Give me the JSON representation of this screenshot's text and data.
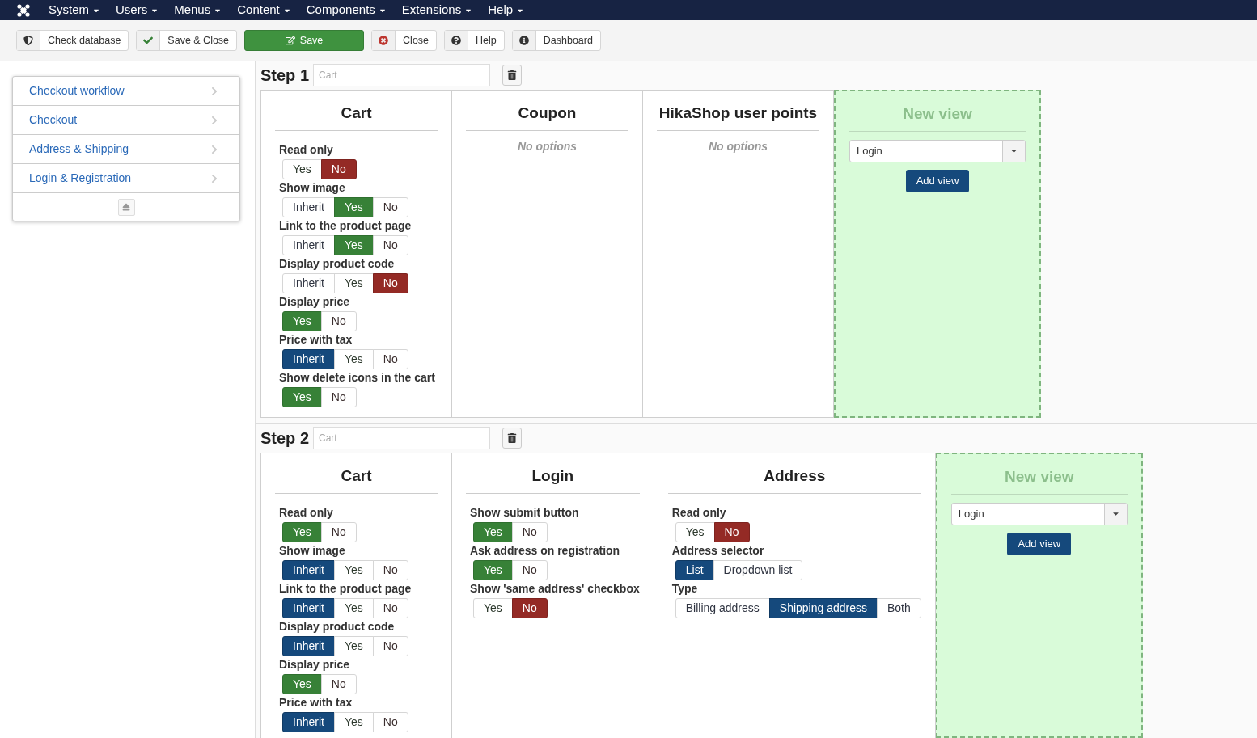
{
  "menubar": {
    "items": [
      {
        "label": "System"
      },
      {
        "label": "Users"
      },
      {
        "label": "Menus"
      },
      {
        "label": "Content"
      },
      {
        "label": "Components"
      },
      {
        "label": "Extensions"
      },
      {
        "label": "Help"
      }
    ]
  },
  "toolbar": [
    {
      "label": "Check database",
      "kind": "shield"
    },
    {
      "label": "Save & Close",
      "kind": "check"
    },
    {
      "label": "Save",
      "kind": "save"
    },
    {
      "label": "Close",
      "kind": "close"
    },
    {
      "label": "Help",
      "kind": "help"
    },
    {
      "label": "Dashboard",
      "kind": "info"
    }
  ],
  "sidebar": {
    "items": [
      {
        "label": "Checkout workflow"
      },
      {
        "label": "Checkout"
      },
      {
        "label": "Address & Shipping"
      },
      {
        "label": "Login & Registration"
      }
    ]
  },
  "steps": [
    {
      "label": "Step 1",
      "name_placeholder": "Cart",
      "views": [
        {
          "kind": "settings",
          "title": "Cart",
          "options": [
            {
              "label": "Read only",
              "choices": [
                {
                  "label": "Yes",
                  "kind": "yes",
                  "selected": false
                },
                {
                  "label": "No",
                  "kind": "no",
                  "selected": true
                }
              ]
            },
            {
              "label": "Show image",
              "choices": [
                {
                  "label": "Inherit",
                  "kind": "other",
                  "selected": false
                },
                {
                  "label": "Yes",
                  "kind": "yes",
                  "selected": true
                },
                {
                  "label": "No",
                  "kind": "no",
                  "selected": false
                }
              ]
            },
            {
              "label": "Link to the product page",
              "choices": [
                {
                  "label": "Inherit",
                  "kind": "other",
                  "selected": false
                },
                {
                  "label": "Yes",
                  "kind": "yes",
                  "selected": true
                },
                {
                  "label": "No",
                  "kind": "no",
                  "selected": false
                }
              ]
            },
            {
              "label": "Display product code",
              "choices": [
                {
                  "label": "Inherit",
                  "kind": "other",
                  "selected": false
                },
                {
                  "label": "Yes",
                  "kind": "yes",
                  "selected": false
                },
                {
                  "label": "No",
                  "kind": "no",
                  "selected": true
                }
              ]
            },
            {
              "label": "Display price",
              "choices": [
                {
                  "label": "Yes",
                  "kind": "yes",
                  "selected": true
                },
                {
                  "label": "No",
                  "kind": "no",
                  "selected": false
                }
              ]
            },
            {
              "label": "Price with tax",
              "choices": [
                {
                  "label": "Inherit",
                  "kind": "other",
                  "selected": true
                },
                {
                  "label": "Yes",
                  "kind": "yes",
                  "selected": false
                },
                {
                  "label": "No",
                  "kind": "no",
                  "selected": false
                }
              ]
            },
            {
              "label": "Show delete icons in the cart",
              "choices": [
                {
                  "label": "Yes",
                  "kind": "yes",
                  "selected": true
                },
                {
                  "label": "No",
                  "kind": "no",
                  "selected": false
                }
              ]
            }
          ]
        },
        {
          "kind": "empty",
          "title": "Coupon",
          "note": "No options"
        },
        {
          "kind": "empty",
          "title": "HikaShop user points",
          "note": "No options"
        }
      ],
      "new_view": {
        "title": "New view",
        "select_value": "Login",
        "button": "Add view"
      }
    },
    {
      "label": "Step 2",
      "name_placeholder": "Cart",
      "views": [
        {
          "kind": "settings",
          "title": "Cart",
          "options": [
            {
              "label": "Read only",
              "choices": [
                {
                  "label": "Yes",
                  "kind": "yes",
                  "selected": true
                },
                {
                  "label": "No",
                  "kind": "no",
                  "selected": false
                }
              ]
            },
            {
              "label": "Show image",
              "choices": [
                {
                  "label": "Inherit",
                  "kind": "other",
                  "selected": true
                },
                {
                  "label": "Yes",
                  "kind": "yes",
                  "selected": false
                },
                {
                  "label": "No",
                  "kind": "no",
                  "selected": false
                }
              ]
            },
            {
              "label": "Link to the product page",
              "choices": [
                {
                  "label": "Inherit",
                  "kind": "other",
                  "selected": true
                },
                {
                  "label": "Yes",
                  "kind": "yes",
                  "selected": false
                },
                {
                  "label": "No",
                  "kind": "no",
                  "selected": false
                }
              ]
            },
            {
              "label": "Display product code",
              "choices": [
                {
                  "label": "Inherit",
                  "kind": "other",
                  "selected": true
                },
                {
                  "label": "Yes",
                  "kind": "yes",
                  "selected": false
                },
                {
                  "label": "No",
                  "kind": "no",
                  "selected": false
                }
              ]
            },
            {
              "label": "Display price",
              "choices": [
                {
                  "label": "Yes",
                  "kind": "yes",
                  "selected": true
                },
                {
                  "label": "No",
                  "kind": "no",
                  "selected": false
                }
              ]
            },
            {
              "label": "Price with tax",
              "choices": [
                {
                  "label": "Inherit",
                  "kind": "other",
                  "selected": true
                },
                {
                  "label": "Yes",
                  "kind": "yes",
                  "selected": false
                },
                {
                  "label": "No",
                  "kind": "no",
                  "selected": false
                }
              ]
            }
          ]
        },
        {
          "kind": "settings",
          "title": "Login",
          "options": [
            {
              "label": "Show submit button",
              "choices": [
                {
                  "label": "Yes",
                  "kind": "yes",
                  "selected": true
                },
                {
                  "label": "No",
                  "kind": "no",
                  "selected": false
                }
              ]
            },
            {
              "label": "Ask address on registration",
              "choices": [
                {
                  "label": "Yes",
                  "kind": "yes",
                  "selected": true
                },
                {
                  "label": "No",
                  "kind": "no",
                  "selected": false
                }
              ]
            },
            {
              "label": "Show 'same address' checkbox",
              "choices": [
                {
                  "label": "Yes",
                  "kind": "yes",
                  "selected": false
                },
                {
                  "label": "No",
                  "kind": "no",
                  "selected": true
                }
              ]
            }
          ]
        },
        {
          "kind": "settings",
          "title": "Address",
          "options": [
            {
              "label": "Read only",
              "choices": [
                {
                  "label": "Yes",
                  "kind": "yes",
                  "selected": false
                },
                {
                  "label": "No",
                  "kind": "no",
                  "selected": true
                }
              ]
            },
            {
              "label": "Address selector",
              "choices": [
                {
                  "label": "List",
                  "kind": "other",
                  "selected": true
                },
                {
                  "label": "Dropdown list",
                  "kind": "other",
                  "selected": false
                }
              ]
            },
            {
              "label": "Type",
              "choices": [
                {
                  "label": "Billing address",
                  "kind": "other",
                  "selected": false
                },
                {
                  "label": "Shipping address",
                  "kind": "other",
                  "selected": true
                },
                {
                  "label": "Both",
                  "kind": "other",
                  "selected": false
                }
              ]
            }
          ]
        }
      ],
      "new_view": {
        "title": "New view",
        "select_value": "Login",
        "button": "Add view"
      }
    }
  ]
}
